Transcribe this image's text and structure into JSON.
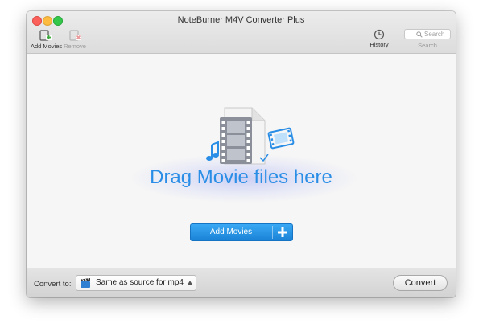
{
  "window": {
    "title": "NoteBurner M4V Converter Plus"
  },
  "toolbar": {
    "add_movies_label": "Add Movies",
    "remove_label": "Remove",
    "history_label": "History",
    "search_placeholder": "Search",
    "search_label": "Search"
  },
  "main": {
    "drag_text": "Drag Movie files here",
    "add_button_label": "Add Movies"
  },
  "bottom": {
    "convert_to_label": "Convert to:",
    "format_value": "Same as source for mp4",
    "convert_button_label": "Convert"
  },
  "colors": {
    "accent": "#2a8ee6",
    "button_blue": "#1a82d6",
    "close": "#fc605b",
    "minimize": "#fdbc40",
    "maximize": "#34c84a"
  },
  "icons": {
    "add_movies": "add-movies-icon",
    "remove": "remove-icon",
    "history": "clock-icon",
    "search": "magnifier-icon",
    "drop_art": "film-document-music-icon",
    "plus": "plus-icon",
    "format": "clapperboard-icon",
    "dropdown": "triangle-up-icon"
  }
}
